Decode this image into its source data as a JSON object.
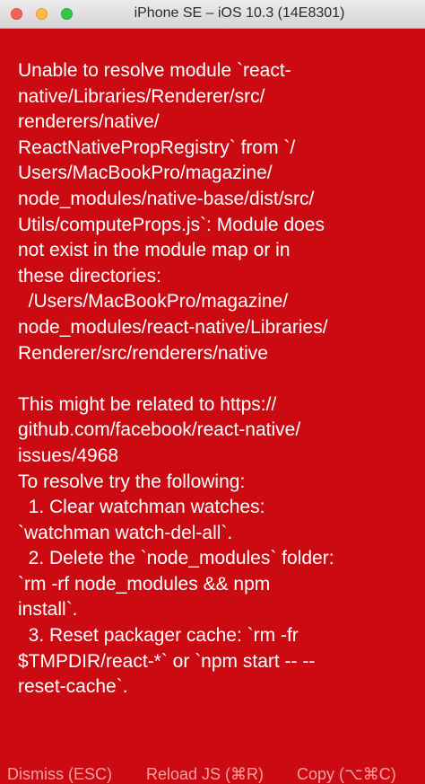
{
  "window": {
    "title": "iPhone SE – iOS 10.3 (14E8301)"
  },
  "error": {
    "message": "Unable to resolve module `react-\nnative/Libraries/Renderer/src/\nrenderers/native/\nReactNativePropRegistry` from `/\nUsers/MacBookPro/magazine/\nnode_modules/native-base/dist/src/\nUtils/computeProps.js`: Module does\nnot exist in the module map or in\nthese directories:\n  /Users/MacBookPro/magazine/\nnode_modules/react-native/Libraries/\nRenderer/src/renderers/native\n\nThis might be related to https://\ngithub.com/facebook/react-native/\nissues/4968\nTo resolve try the following:\n  1. Clear watchman watches:\n`watchman watch-del-all`.\n  2. Delete the `node_modules` folder:\n`rm -rf node_modules && npm\ninstall`.\n  3. Reset packager cache: `rm -fr\n$TMPDIR/react-*` or `npm start -- --\nreset-cache`."
  },
  "footer": {
    "dismiss_label": "Dismiss (ESC)",
    "reload_label": "Reload JS (⌘R)",
    "copy_label": "Copy (⌥⌘C)"
  },
  "colors": {
    "background": "#cc0a12",
    "text": "#ffffff",
    "footer_text": "#f2a2a2"
  }
}
